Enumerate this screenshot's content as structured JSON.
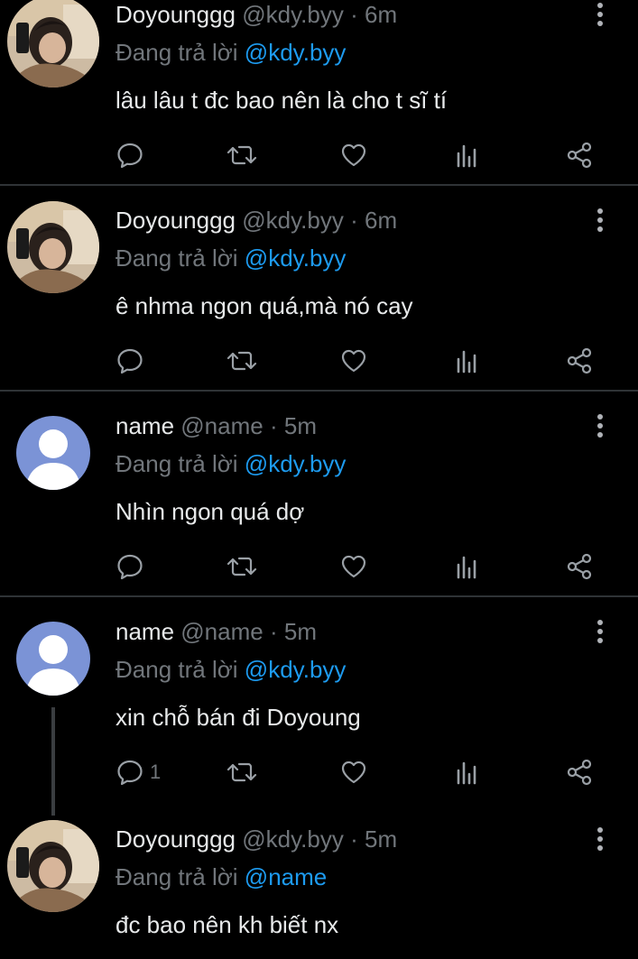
{
  "colors": {
    "background": "#000000",
    "text": "#e7e9ea",
    "muted": "#71767b",
    "link": "#1d9bf0",
    "divider": "#2f3336",
    "default_avatar_bg": "#7b93d6"
  },
  "replies": [
    {
      "display_name": "Doyounggg",
      "handle": "@kdy.byy",
      "separator": "·",
      "time": "6m",
      "replying_prefix": "Đang trả lời",
      "replying_to": "@kdy.byy",
      "text": "lâu lâu t đc bao nên là cho t sĩ tí",
      "avatar": "photo-avatar",
      "reply_count": ""
    },
    {
      "display_name": "Doyounggg",
      "handle": "@kdy.byy",
      "separator": "·",
      "time": "6m",
      "replying_prefix": "Đang trả lời",
      "replying_to": "@kdy.byy",
      "text": "ê nhma ngon quá,mà nó cay",
      "avatar": "photo-avatar",
      "reply_count": ""
    },
    {
      "display_name": "name",
      "handle": "@name",
      "separator": "·",
      "time": "5m",
      "replying_prefix": "Đang trả lời",
      "replying_to": "@kdy.byy",
      "text": "Nhìn ngon quá dợ",
      "avatar": "default-avatar",
      "reply_count": ""
    },
    {
      "display_name": "name",
      "handle": "@name",
      "separator": "·",
      "time": "5m",
      "replying_prefix": "Đang trả lời",
      "replying_to": "@kdy.byy",
      "text": "xin chỗ bán đi Doyoung",
      "avatar": "default-avatar",
      "reply_count": "1"
    },
    {
      "display_name": "Doyounggg",
      "handle": "@kdy.byy",
      "separator": "·",
      "time": "5m",
      "replying_prefix": "Đang trả lời",
      "replying_to": "@name",
      "text": "đc bao nên kh biết nx",
      "avatar": "photo-avatar",
      "reply_count": ""
    }
  ],
  "icons": {
    "reply": "reply-icon",
    "retweet": "retweet-icon",
    "like": "heart-icon",
    "views": "views-icon",
    "share": "share-icon",
    "more": "more-vertical-icon"
  }
}
